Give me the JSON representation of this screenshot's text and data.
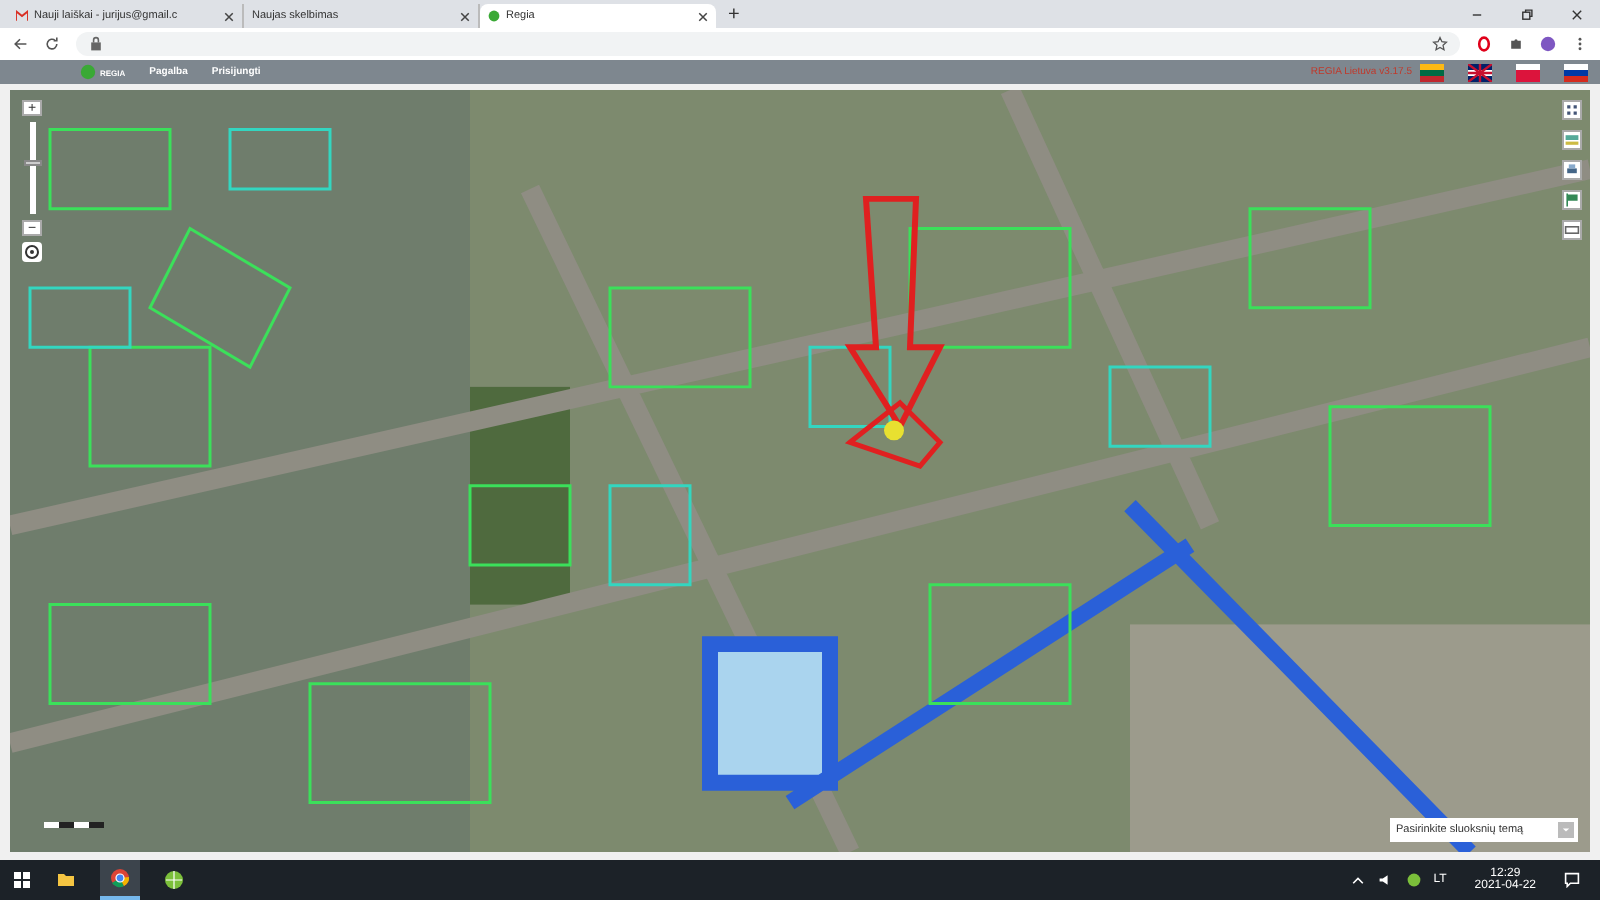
{
  "browser": {
    "tabs": [
      {
        "label": "Nauji laiškai - jurijus@gmail.c",
        "selected": false
      },
      {
        "label": "Naujas skelbimas",
        "selected": false
      },
      {
        "label": "Regia",
        "selected": true
      }
    ],
    "new_tab": "+"
  },
  "app_header": {
    "logo": "REGIA",
    "menu": [
      "Pagalba",
      "Prisijungti"
    ],
    "version": "REGIA Lietuva v3.17.5",
    "languages": [
      {
        "selected": false
      },
      {
        "selected": false
      },
      {
        "selected": false
      },
      {
        "selected": false
      }
    ]
  },
  "map": {
    "zoom_in": "+",
    "zoom_out": "−",
    "zoom": {
      "level": 0.55
    },
    "theme_select": {
      "placeholder": "Pasirinkite sluoksnių temą"
    }
  },
  "taskbar": {
    "tray": {
      "language": "LT",
      "time": "12:29",
      "date": "2021-04-22"
    }
  }
}
